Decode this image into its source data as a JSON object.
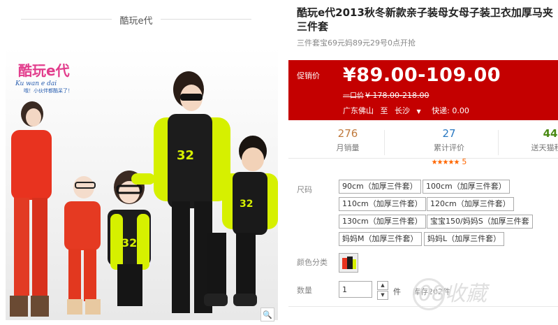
{
  "store": {
    "name": "酷玩e代"
  },
  "product": {
    "title": "酷玩e代2013秋冬新款亲子装母女母子装卫衣加厚马夹三件套",
    "subtitle": "三件套宝69元妈89元29号0点开抢",
    "logo_main": "酷玩e代",
    "logo_pinyin": "Ku wan e dai",
    "logo_slogan": "哦！小伙伴都酷呆了！",
    "shirt_text": "32"
  },
  "price": {
    "promo_label": "促销价",
    "current": "¥89.00-109.00",
    "old_label": "一口价",
    "old": "¥ 178.00-218.00",
    "from": "广东佛山",
    "to_word": "至",
    "to": "长沙",
    "express": "快递: 0.00"
  },
  "stats": {
    "sales_num": "276",
    "sales_label": "月销量",
    "reviews_num": "27",
    "reviews_label": "累计评价",
    "stars": "★★★★★",
    "score": "5",
    "points_num": "44",
    "points_label": "送天猫积分"
  },
  "sku": {
    "size_label": "尺码",
    "sizes": [
      "90cm（加厚三件套）",
      "100cm（加厚三件套）",
      "110cm（加厚三件套）",
      "120cm（加厚三件套）",
      "130cm（加厚三件套）",
      "宝宝150/妈妈S（加厚三件套",
      "妈妈M（加厚三件套）",
      "妈妈L（加厚三件套）"
    ],
    "color_label": "颜色分类",
    "qty_label": "数量",
    "qty_value": "1",
    "qty_unit": "件",
    "stock": "库存202件"
  },
  "watermark": "08收藏",
  "colors": {
    "price_red": "#c40000",
    "accent_yellow": "#d6f000"
  }
}
